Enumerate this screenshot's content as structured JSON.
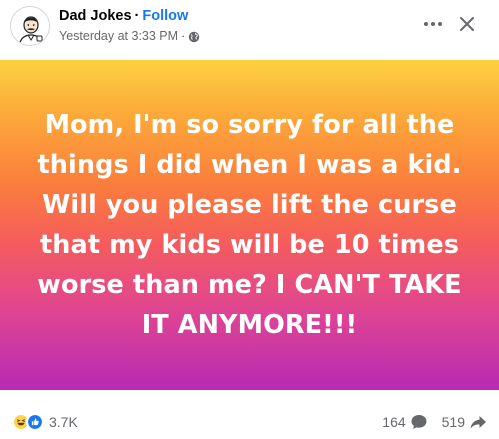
{
  "header": {
    "page_name": "Dad Jokes",
    "separator": "·",
    "follow_label": "Follow",
    "timestamp": "Yesterday at 3:33 PM",
    "meta_separator": "·",
    "privacy_icon": "globe-icon",
    "more_icon": "more-options-icon",
    "close_icon": "close-icon"
  },
  "post": {
    "text": "Mom, I'm so sorry for all the things I did when I was a kid. Will you please lift the curse that my kids will be 10 times worse than me? I CAN'T TAKE IT ANYMORE!!!",
    "gradient_colors": [
      "#fdd03f",
      "#fb7d3c",
      "#e04592",
      "#b72ab4"
    ],
    "text_color": "#ffffff"
  },
  "footer": {
    "reaction_icons": [
      "haha-icon",
      "like-icon"
    ],
    "reaction_count": "3.7K",
    "comment_count": "164",
    "comment_icon": "comment-icon",
    "share_count": "519",
    "share_icon": "share-icon"
  },
  "colors": {
    "accent": "#1877f2",
    "secondary_text": "#65676b",
    "primary_text": "#050505"
  }
}
